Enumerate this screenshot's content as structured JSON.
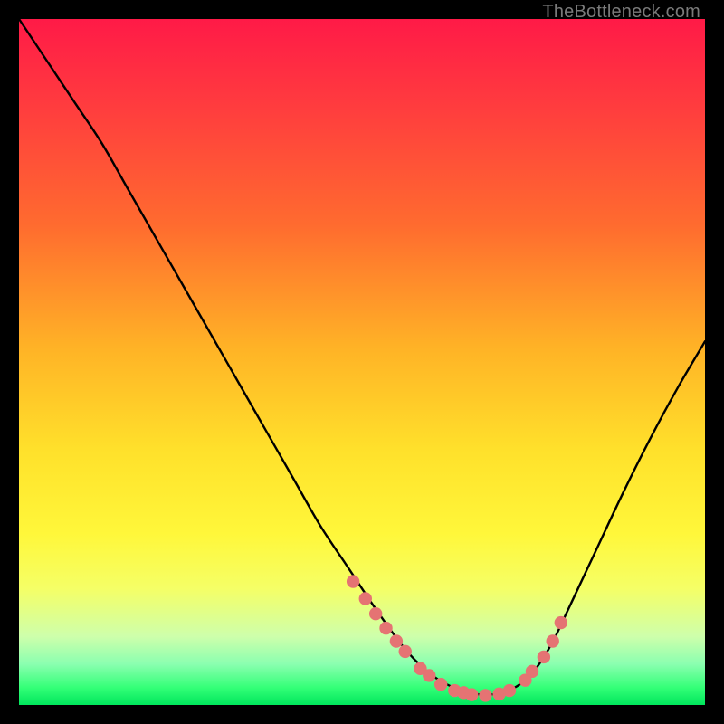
{
  "watermark": "TheBottleneck.com",
  "colors": {
    "background": "#000000",
    "gradient_top": "#ff1a47",
    "gradient_bottom": "#00e65c",
    "curve": "#000000",
    "dot_fill": "#e57373",
    "dot_stroke": "#cc5a5a"
  },
  "chart_data": {
    "type": "line",
    "title": "",
    "xlabel": "",
    "ylabel": "",
    "xlim": [
      0,
      100
    ],
    "ylim": [
      0,
      100
    ],
    "x": [
      0,
      4,
      8,
      12,
      16,
      20,
      24,
      28,
      32,
      36,
      40,
      44,
      48,
      52,
      56,
      58,
      60,
      62,
      64,
      66,
      68,
      70,
      72,
      74,
      76,
      78,
      80,
      84,
      88,
      92,
      96,
      100
    ],
    "y": [
      100,
      94,
      88,
      82,
      75,
      68,
      61,
      54,
      47,
      40,
      33,
      26,
      20,
      14,
      8.5,
      6.3,
      4.5,
      3.2,
      2.3,
      1.7,
      1.5,
      1.7,
      2.4,
      3.8,
      6.2,
      9.6,
      13.8,
      22.3,
      30.8,
      38.8,
      46.2,
      53.0
    ],
    "dots_x": [
      48.7,
      50.5,
      52.0,
      53.5,
      55.0,
      56.3,
      58.5,
      59.8,
      61.5,
      63.5,
      64.8,
      66.0,
      68.0,
      70.0,
      71.5,
      73.8,
      74.8,
      76.5,
      77.8,
      79.0
    ],
    "dots_y": [
      18.0,
      15.5,
      13.3,
      11.2,
      9.3,
      7.8,
      5.3,
      4.3,
      3.0,
      2.1,
      1.8,
      1.5,
      1.4,
      1.6,
      2.1,
      3.6,
      4.9,
      7.0,
      9.3,
      12.0
    ],
    "note": "x and y are in percent of the plot area (0-100). y is measured from the bottom of the gradient (0 = bottom/green, 100 = top/red). dots_* mark the salmon-colored highlighted points along the curve near its minimum."
  }
}
